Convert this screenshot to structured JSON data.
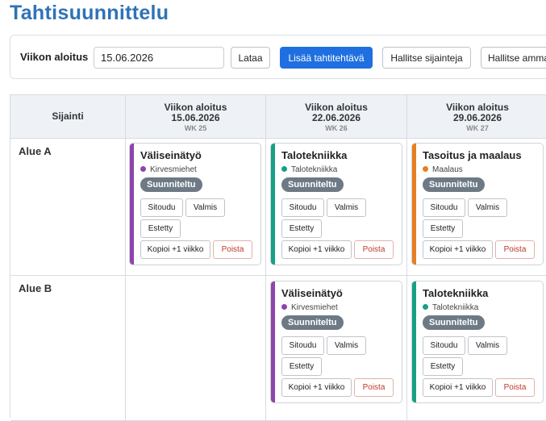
{
  "page": {
    "title": "Tahtisuunnittelu"
  },
  "toolbar": {
    "week_start_label": "Viikon aloitus",
    "week_start_value": "15.06.2026",
    "load_label": "Lataa",
    "add_label": "Lisää tahtitehtävä",
    "manage_locations_label": "Hallitse sijainteja",
    "manage_trades_label": "Hallitse amma"
  },
  "grid": {
    "corner_label": "Sijainti",
    "weeks": [
      {
        "label": "Viikon aloitus",
        "date": "15.06.2026",
        "wk": "WK 25"
      },
      {
        "label": "Viikon aloitus",
        "date": "22.06.2026",
        "wk": "WK 26"
      },
      {
        "label": "Viikon aloitus",
        "date": "29.06.2026",
        "wk": "WK 27"
      }
    ],
    "locations": [
      {
        "name": "Alue A"
      },
      {
        "name": "Alue B"
      }
    ]
  },
  "card_actions": {
    "commit": "Sitoudu",
    "done": "Valmis",
    "blocked": "Estetty",
    "copy": "Kopioi +1 viikko",
    "delete": "Poista"
  },
  "cards": [
    {
      "title": "Väliseinätyö",
      "trade": "Kirvesmiehet",
      "status": "Suunniteltu",
      "color": "#8e44ad"
    },
    {
      "title": "Talotekniikka",
      "trade": "Talotekniikka",
      "status": "Suunniteltu",
      "color": "#16a085"
    },
    {
      "title": "Tasoitus ja maalaus",
      "trade": "Maalaus",
      "status": "Suunniteltu",
      "color": "#e67e22"
    },
    {
      "title": "Väliseinätyö",
      "trade": "Kirvesmiehet",
      "status": "Suunniteltu",
      "color": "#8e44ad"
    },
    {
      "title": "Talotekniikka",
      "trade": "Talotekniikka",
      "status": "Suunniteltu",
      "color": "#16a085"
    }
  ],
  "colors": {
    "accent": "#1f6fe0",
    "title": "#2f72b8",
    "status_badge": "#6d7a86",
    "danger": "#c0392b"
  }
}
